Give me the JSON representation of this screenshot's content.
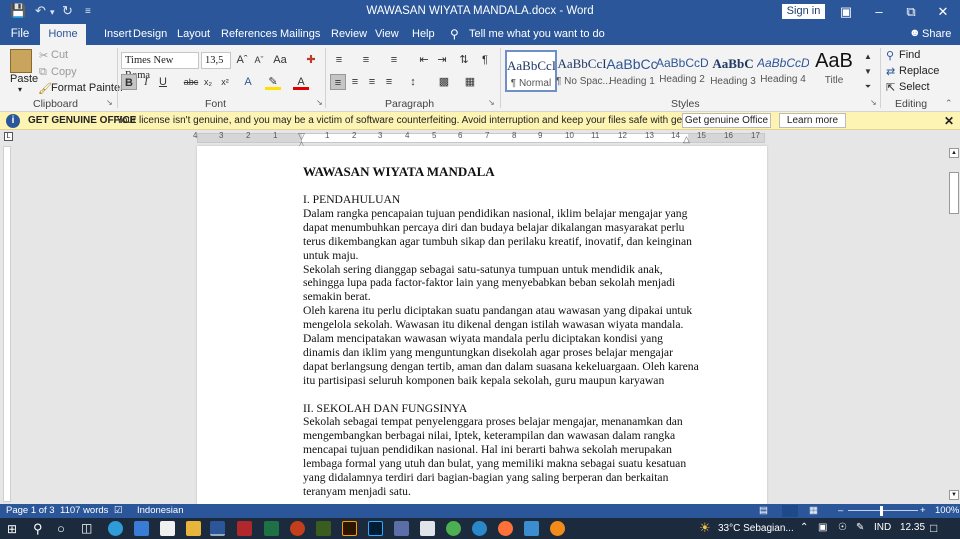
{
  "app": {
    "title": "WAWASAN WIYATA MANDALA.docx - Word",
    "sign_in": "Sign in"
  },
  "tabs": [
    "File",
    "Home",
    "Insert",
    "Design",
    "Layout",
    "References",
    "Mailings",
    "Review",
    "View",
    "Help"
  ],
  "tell_me": "Tell me what you want to do",
  "share": "Share",
  "clipboard": {
    "paste": "Paste",
    "cut": "Cut",
    "copy": "Copy",
    "format_painter": "Format Painter",
    "group": "Clipboard"
  },
  "font": {
    "name": "Times New Roma",
    "size": "13,5",
    "group": "Font"
  },
  "paragraph": {
    "group": "Paragraph"
  },
  "styles": {
    "group": "Styles",
    "items": [
      {
        "preview": "AaBbCcI",
        "name": "¶ Normal"
      },
      {
        "preview": "AaBbCcI",
        "name": "¶ No Spac..."
      },
      {
        "preview": "AaBbCc",
        "name": "Heading 1"
      },
      {
        "preview": "AaBbCcD",
        "name": "Heading 2"
      },
      {
        "preview": "AaBbC",
        "name": "Heading 3"
      },
      {
        "preview": "AaBbCcD",
        "name": "Heading 4"
      },
      {
        "preview": "AaB",
        "name": "Title"
      }
    ]
  },
  "editing": {
    "find": "Find",
    "replace": "Replace",
    "select": "Select",
    "group": "Editing"
  },
  "message": {
    "title": "GET GENUINE OFFICE",
    "text": "Your license isn't genuine, and you may be a victim of software counterfeiting. Avoid interruption and keep your files safe with genuine Office today.",
    "btn1": "Get genuine Office",
    "btn2": "Learn more"
  },
  "ruler_numbers": [
    "4",
    "3",
    "2",
    "1",
    "1",
    "2",
    "3",
    "4",
    "5",
    "6",
    "7",
    "8",
    "9",
    "10",
    "11",
    "12",
    "13",
    "14",
    "15",
    "16",
    "17"
  ],
  "doc": {
    "title": "WAWASAN WIYATA MANDALA",
    "lines": [
      "I. PENDAHULUAN",
      "Dalam rangka pencapaian tujuan pendidikan nasional, iklim belajar mengajar yang",
      "dapat menumbuhkan percaya diri dan budaya belajar dikalangan masyarakat perlu",
      "terus dikembangkan agar tumbuh sikap dan perilaku kreatif, inovatif, dan keinginan",
      "untuk maju.",
      "Sekolah sering dianggap sebagai satu-satunya tumpuan untuk mendidik anak,",
      "sehingga lupa pada factor-faktor lain yang menyebabkan beban sekolah menjadi",
      "semakin berat.",
      "Oleh karena itu perlu diciptakan suatu pandangan atau wawasan yang dipakai untuk",
      "mengelola sekolah. Wawasan itu dikenal dengan istilah wawasan wiyata mandala.",
      "Dalam mencipatakan wawasan wiyata mandala perlu diciptakan kondisi yang",
      "dinamis dan iklim yang menguntungkan disekolah agar proses belajar mengajar",
      "dapat berlangsung dengan tertib, aman dan dalam suasana kekeluargaan. Oleh karena",
      "itu partisipasi seluruh komponen baik kepala sekolah, guru maupun karyawan",
      "",
      "II. SEKOLAH DAN FUNGSINYA",
      "Sekolah sebagai tempat penyelenggara proses belajar mengajar, menanamkan dan",
      "mengembangkan berbagai nilai, Iptek, keterampilan dan wawasan dalam rangka",
      "mencapai tujuan pendidikan nasional. Hal ini berarti bahwa sekolah merupakan",
      "lembaga formal yang utuh dan bulat, yang memiliki makna sebagai suatu kesatuan",
      "yang didalamnya terdiri dari bagian-bagian yang saling berperan dan berkaitan",
      "teranyam menjadi satu."
    ]
  },
  "status": {
    "page": "Page 1 of 3",
    "words": "1107 words",
    "language": "Indonesian",
    "zoom": "100%"
  },
  "taskbar": {
    "weather": "33°C  Sebagian...",
    "lang": "IND",
    "time": "12.35"
  }
}
